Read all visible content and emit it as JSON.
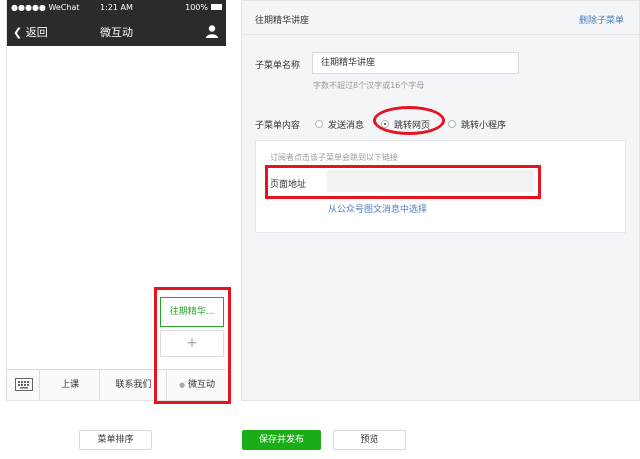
{
  "phone": {
    "status": {
      "carrier": "●●●●● WeChat",
      "time": "1:21 AM",
      "battery": "100%"
    },
    "nav": {
      "back_label": "返回",
      "title": "微互动"
    },
    "menu": {
      "items": [
        "上课",
        "联系我们",
        "微互动"
      ],
      "submenu_item": "往期精华...",
      "add_symbol": "+"
    }
  },
  "panel": {
    "title": "往期精华讲座",
    "delete_label": "删除子菜单",
    "name_label": "子菜单名称",
    "name_value": "往期精华讲座",
    "name_hint": "字数不超过8个汉字或16个字母",
    "content_label": "子菜单内容",
    "content_options": [
      "发送消息",
      "跳转网页",
      "跳转小程序"
    ],
    "selected_option": "跳转网页",
    "card": {
      "hint": "订阅者点击该子菜单会跳到以下链接",
      "url_label": "页面地址",
      "url_value": "",
      "link_label": "从公众号图文消息中选择"
    }
  },
  "footer": {
    "sort_label": "菜单排序",
    "publish_label": "保存并发布",
    "preview_label": "预览"
  },
  "colors": {
    "accent": "#1aad19",
    "highlight": "#e5141f",
    "link": "#4b7fb8",
    "dark_bar": "#2b2b2b"
  }
}
